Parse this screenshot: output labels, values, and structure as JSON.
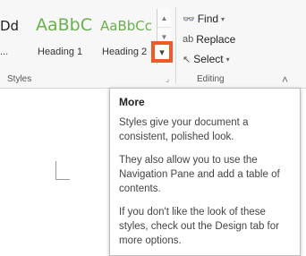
{
  "styles_group": {
    "items": [
      {
        "sample": "Dd",
        "name": "..."
      },
      {
        "sample": "AaBbC",
        "name": "Heading 1"
      },
      {
        "sample": "AaBbCc",
        "name": "Heading 2"
      }
    ],
    "label": "Styles"
  },
  "editing_group": {
    "find_label": "Find",
    "replace_label": "Replace",
    "select_label": "Select",
    "label": "Editing"
  },
  "tooltip": {
    "title": "More",
    "paragraphs": [
      "Styles give your document a consistent, polished look.",
      "They also allow you to use the Navigation Pane and add a table of contents.",
      "If you don't like the look of these styles, check out the Design tab for more options."
    ]
  },
  "colors": {
    "accent_highlight": "#f05a24",
    "heading_green": "#6ab04c"
  }
}
